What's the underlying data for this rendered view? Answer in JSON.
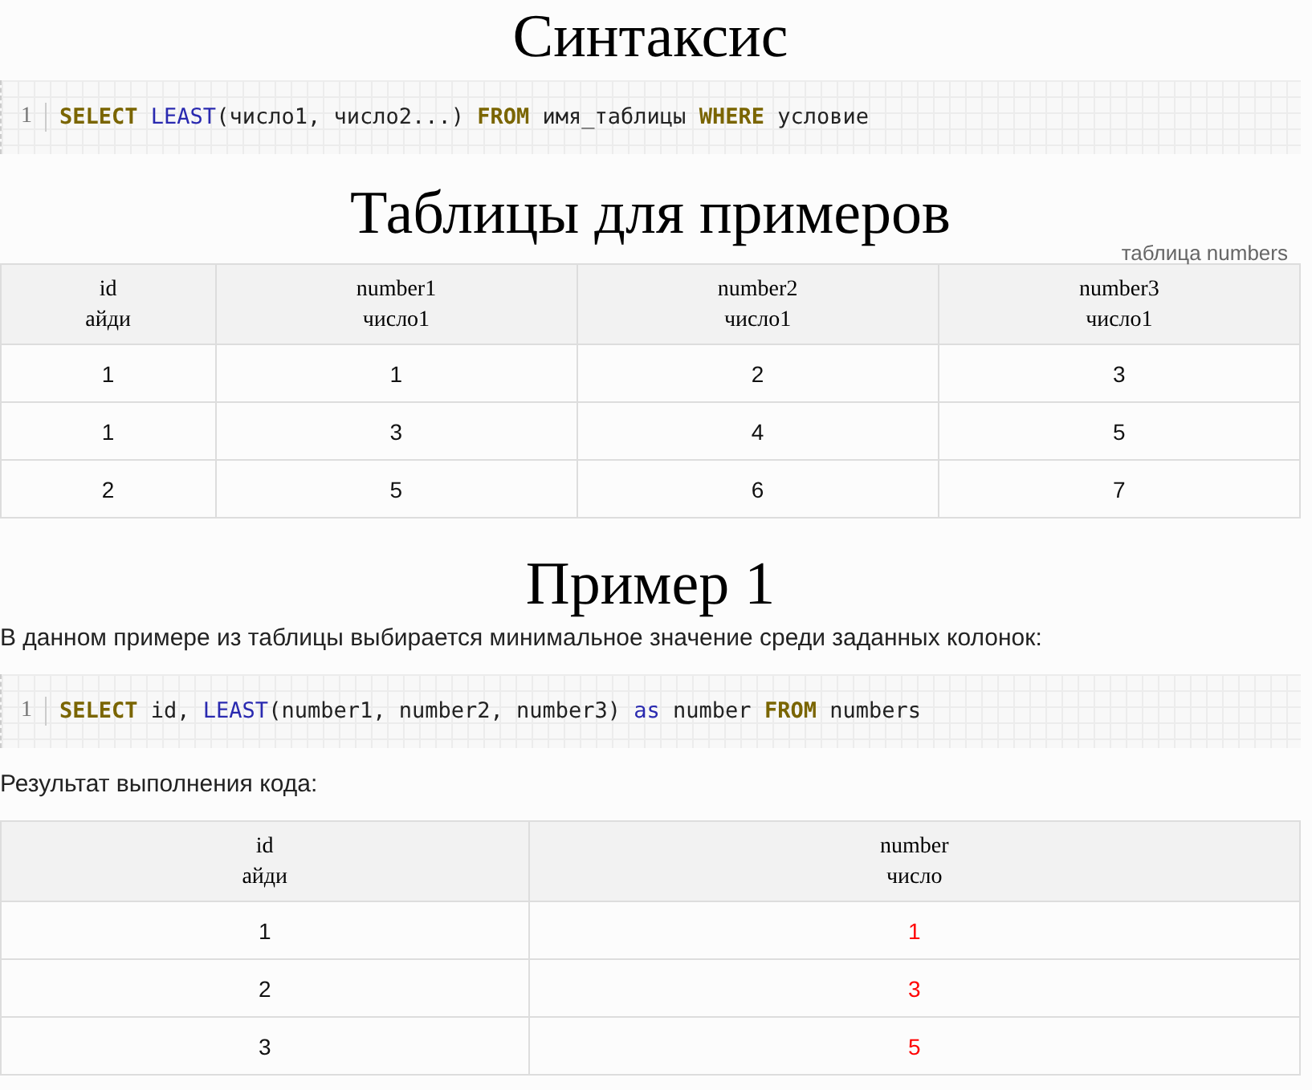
{
  "sections": [
    {
      "kind": "code",
      "heading": "Синтаксис",
      "line_number": "1",
      "tokens": [
        {
          "kind": "keyword",
          "text": "SELECT"
        },
        {
          "kind": "function",
          "text": "LEAST",
          "space_before": true
        },
        {
          "kind": "plain",
          "text": "(число1, число2...) "
        },
        {
          "kind": "keyword",
          "text": "FROM"
        },
        {
          "kind": "plain",
          "text": " имя_таблицы "
        },
        {
          "kind": "keyword",
          "text": "WHERE"
        },
        {
          "kind": "plain",
          "text": " условие"
        }
      ]
    },
    {
      "kind": "table",
      "heading": "Таблицы для примеров",
      "caption": "таблица numbers",
      "columns": [
        {
          "name": "id",
          "subtitle": "айди",
          "highlighted": false
        },
        {
          "name": "number1",
          "subtitle": "число1",
          "highlighted": false
        },
        {
          "name": "number2",
          "subtitle": "число1",
          "highlighted": false
        },
        {
          "name": "number3",
          "subtitle": "число1",
          "highlighted": false
        }
      ],
      "rows": [
        [
          "1",
          "1",
          "2",
          "3"
        ],
        [
          "1",
          "3",
          "4",
          "5"
        ],
        [
          "2",
          "5",
          "6",
          "7"
        ]
      ]
    },
    {
      "kind": "code",
      "heading": "Пример 1",
      "intro": "В данном примере из таблицы выбирается минимальное значение среди заданных колонок:",
      "line_number": "1",
      "tokens": [
        {
          "kind": "keyword",
          "text": "SELECT"
        },
        {
          "kind": "plain",
          "text": " id, "
        },
        {
          "kind": "function",
          "text": "LEAST"
        },
        {
          "kind": "plain",
          "text": "(number1, number2, number3) "
        },
        {
          "kind": "function",
          "text": "as"
        },
        {
          "kind": "plain",
          "text": " number "
        },
        {
          "kind": "keyword",
          "text": "FROM"
        },
        {
          "kind": "plain",
          "text": " numbers"
        }
      ]
    },
    {
      "kind": "table",
      "intro": "Результат выполнения кода:",
      "columns": [
        {
          "name": "id",
          "subtitle": "айди",
          "highlighted": false
        },
        {
          "name": "number",
          "subtitle": "число",
          "highlighted": true
        }
      ],
      "rows": [
        [
          "1",
          "1"
        ],
        [
          "2",
          "3"
        ],
        [
          "3",
          "5"
        ]
      ]
    }
  ]
}
